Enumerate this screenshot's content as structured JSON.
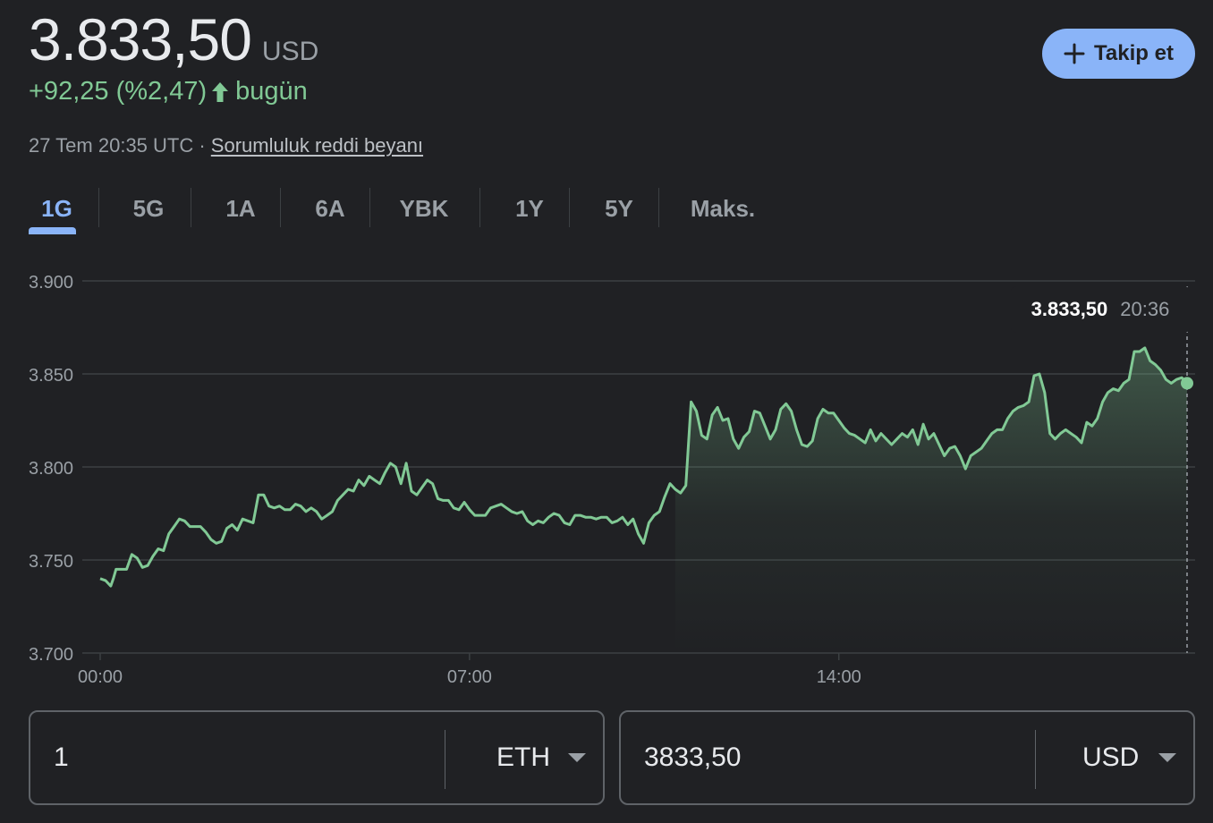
{
  "quote": {
    "price": "3.833,50",
    "currency": "USD",
    "change": "+92,25 (%2,47)",
    "change_period": "bugün",
    "timestamp": "27 Tem 20:35 UTC · ",
    "disclaimer": "Sorumluluk reddi beyanı"
  },
  "follow_button": {
    "label": "Takip et"
  },
  "tabs": [
    {
      "label": "1G",
      "active": true
    },
    {
      "label": "5G"
    },
    {
      "label": "1A"
    },
    {
      "label": "6A"
    },
    {
      "label": "YBK"
    },
    {
      "label": "1Y"
    },
    {
      "label": "5Y"
    },
    {
      "label": "Maks."
    }
  ],
  "tooltip": {
    "value": "3.833,50",
    "time": "20:36"
  },
  "converter": {
    "from_value": "1",
    "from_unit": "ETH",
    "to_value": "3833,50",
    "to_unit": "USD"
  },
  "colors": {
    "background": "#202124",
    "line": "#81c995",
    "accent": "#8ab4f8",
    "grid": "#3c4043",
    "muted_text": "#9aa0a6"
  },
  "chart_data": {
    "type": "line",
    "ylim": [
      3700,
      3900
    ],
    "yticks": [
      3700,
      3750,
      3800,
      3850,
      3900
    ],
    "ytick_labels": [
      "3.700",
      "3.750",
      "3.800",
      "3.850",
      "3.900"
    ],
    "xlim_hours": [
      0,
      20.6
    ],
    "xticks": [
      0,
      7,
      14
    ],
    "xtick_labels": [
      "00:00",
      "07:00",
      "14:00"
    ],
    "grid": true,
    "series": [
      {
        "x_hours": [
          0.0,
          0.1,
          0.2,
          0.25,
          0.3,
          0.4,
          0.5,
          0.6,
          0.7,
          0.8,
          0.9,
          1.0,
          1.1,
          1.2,
          1.3,
          1.4,
          1.5,
          1.6,
          1.7,
          1.8,
          1.9,
          2.0,
          2.1,
          2.2,
          2.3,
          2.4,
          2.5,
          2.6,
          2.7,
          2.8,
          2.9,
          3.0,
          3.1,
          3.2,
          3.3,
          3.4,
          3.5,
          3.6,
          3.7,
          3.8,
          3.9,
          4.0,
          4.1,
          4.2,
          4.3,
          4.4,
          4.5,
          4.6,
          4.7,
          4.8,
          4.9,
          5.0,
          5.1,
          5.2,
          5.3,
          5.4,
          5.5,
          5.6,
          5.7,
          5.8,
          5.9,
          6.0,
          6.1,
          6.2,
          6.3,
          6.4,
          6.5,
          6.6,
          6.7,
          6.8,
          6.9,
          7.0,
          7.1,
          7.2,
          7.3,
          7.4,
          7.5,
          7.6,
          7.7,
          7.8,
          7.9,
          8.0,
          8.1,
          8.2,
          8.3,
          8.4,
          8.5,
          8.6,
          8.7,
          8.8,
          8.9,
          9.0,
          9.1,
          9.2,
          9.3,
          9.4,
          9.5,
          9.6,
          9.7,
          9.8,
          9.9,
          10.0,
          10.1,
          10.2,
          10.3,
          10.4,
          10.5,
          10.6,
          10.7,
          10.8,
          10.9,
          11.0,
          11.1,
          11.2,
          11.3,
          11.4,
          11.5,
          11.6,
          11.7,
          11.8,
          11.9,
          12.0,
          12.1,
          12.2,
          12.3,
          12.4,
          12.5,
          12.6,
          12.7,
          12.8,
          12.9,
          13.0,
          13.1,
          13.2,
          13.3,
          13.4,
          13.5,
          13.6,
          13.7,
          13.8,
          13.9,
          14.0,
          14.1,
          14.2,
          14.3,
          14.4,
          14.5,
          14.6,
          14.7,
          14.8,
          14.9,
          15.0,
          15.1,
          15.2,
          15.3,
          15.4,
          15.5,
          15.6,
          15.7,
          15.8,
          15.9,
          16.0,
          16.1,
          16.2,
          16.3,
          16.4,
          16.5,
          16.6,
          16.7,
          16.8,
          16.9,
          17.0,
          17.1,
          17.2,
          17.3,
          17.4,
          17.5,
          17.6,
          17.7,
          17.8,
          17.9,
          18.0,
          18.1,
          18.2,
          18.3,
          18.4,
          18.5,
          18.6,
          18.7,
          18.8,
          18.9,
          19.0,
          19.1,
          19.2,
          19.3,
          19.4,
          19.5,
          19.6,
          19.7,
          19.8,
          19.9,
          20.0,
          20.1,
          20.2,
          20.3,
          20.4,
          20.5,
          20.6
        ],
        "values": [
          3740,
          3739,
          3736,
          3740,
          3745,
          3745,
          3745,
          3753,
          3751,
          3746,
          3747,
          3752,
          3756,
          3755,
          3764,
          3768,
          3772,
          3771,
          3768,
          3768,
          3768,
          3765,
          3761,
          3759,
          3760,
          3767,
          3769,
          3766,
          3772,
          3771,
          3770,
          3785,
          3785,
          3779,
          3778,
          3779,
          3777,
          3777,
          3780,
          3779,
          3776,
          3778,
          3776,
          3772,
          3774,
          3776,
          3782,
          3785,
          3788,
          3787,
          3793,
          3790,
          3795,
          3793,
          3791,
          3797,
          3802,
          3800,
          3791,
          3802,
          3787,
          3785,
          3789,
          3793,
          3791,
          3783,
          3782,
          3782,
          3778,
          3777,
          3781,
          3777,
          3774,
          3774,
          3774,
          3778,
          3779,
          3780,
          3778,
          3776,
          3775,
          3776,
          3771,
          3769,
          3771,
          3770,
          3773,
          3775,
          3774,
          3770,
          3769,
          3774,
          3774,
          3773,
          3773,
          3772,
          3773,
          3773,
          3770,
          3771,
          3773,
          3769,
          3772,
          3764,
          3759,
          3770,
          3774,
          3776,
          3784,
          3791,
          3788,
          3786,
          3790,
          3835,
          3830,
          3817,
          3815,
          3828,
          3832,
          3825,
          3826,
          3815,
          3810,
          3816,
          3819,
          3830,
          3829,
          3822,
          3815,
          3820,
          3831,
          3834,
          3830,
          3820,
          3812,
          3811,
          3814,
          3826,
          3831,
          3829,
          3829,
          3825,
          3821,
          3818,
          3817,
          3815,
          3813,
          3820,
          3814,
          3818,
          3815,
          3812,
          3815,
          3818,
          3816,
          3820,
          3812,
          3823,
          3815,
          3818,
          3812,
          3806,
          3810,
          3811,
          3806,
          3799,
          3806,
          3808,
          3810,
          3814,
          3818,
          3820,
          3820,
          3826,
          3830,
          3832,
          3833,
          3835,
          3849,
          3850,
          3840,
          3818,
          3815,
          3818,
          3820,
          3818,
          3816,
          3813,
          3824,
          3822,
          3826,
          3835,
          3840,
          3842,
          3841,
          3845,
          3847,
          3862,
          3862,
          3864,
          3857,
          3855,
          3852,
          3847,
          3845,
          3847,
          3848,
          3845,
          3843,
          3840,
          3842,
          3833,
          3832,
          3841,
          3840,
          3836,
          3833,
          3834,
          3833.5
        ]
      }
    ]
  }
}
